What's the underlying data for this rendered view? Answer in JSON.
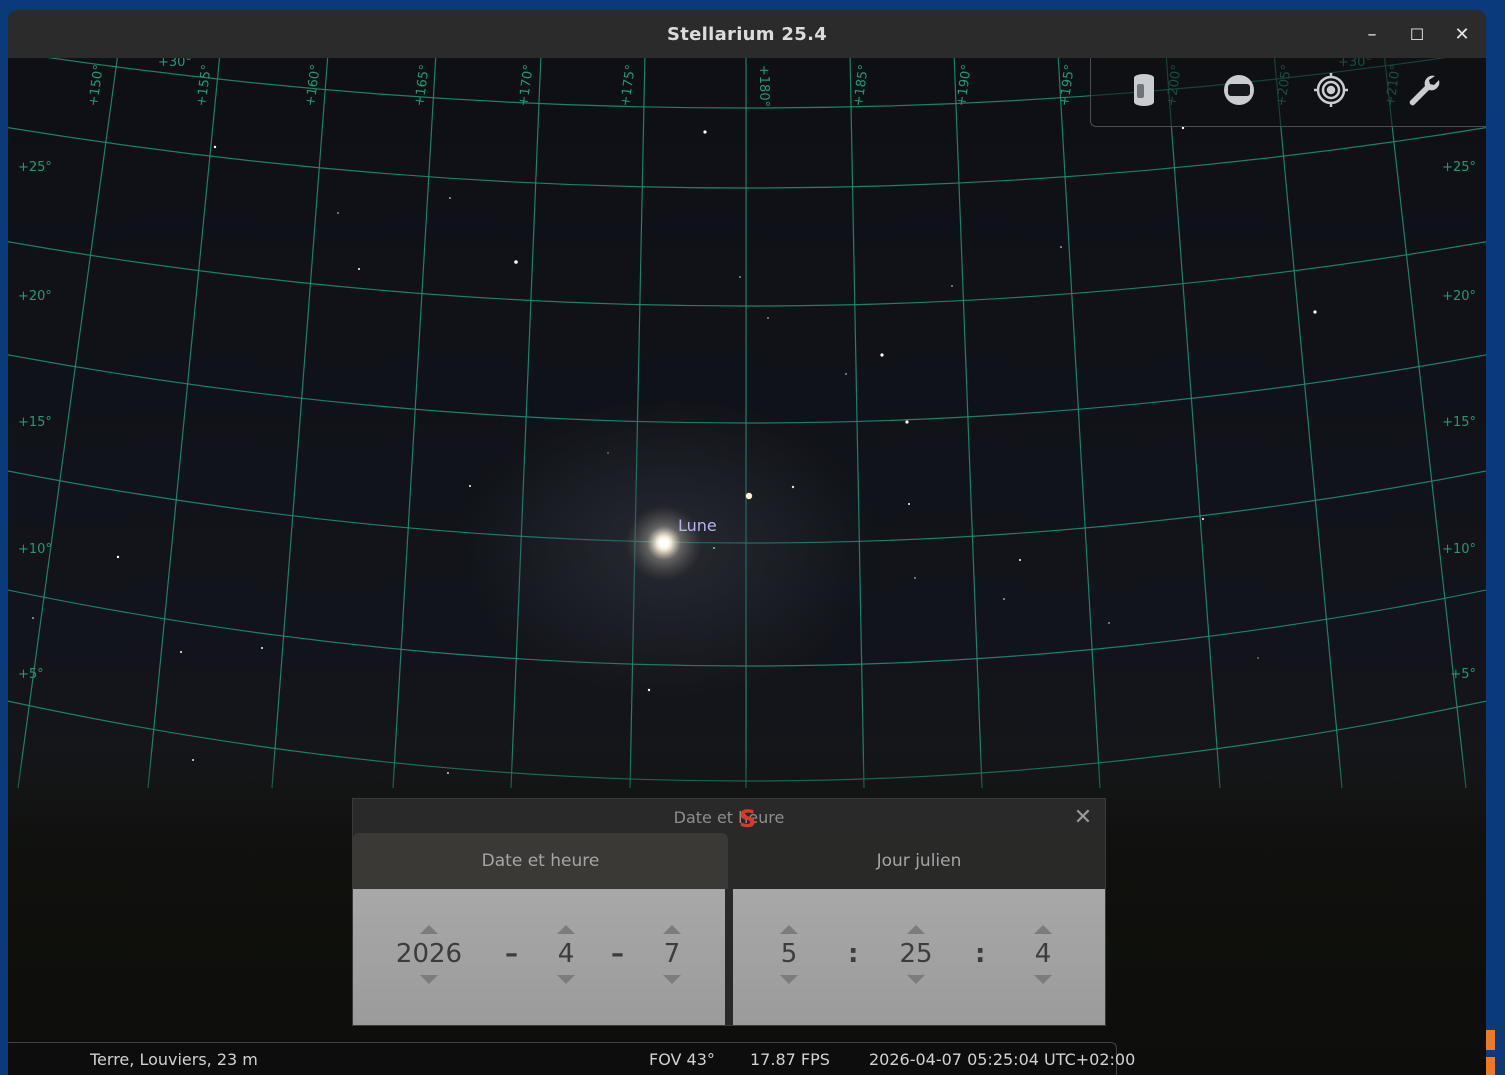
{
  "window": {
    "title": "Stellarium 25.4"
  },
  "controls": {
    "minimize": "–",
    "maximize": "☐",
    "close": "✕"
  },
  "sky": {
    "object_label": "Lune",
    "cardinal": "S",
    "ra_labels": [
      "+150°",
      "+155°",
      "+160°",
      "+165°",
      "+170°",
      "+175°",
      "+180°",
      "+185°",
      "+190°",
      "+195°",
      "+200°",
      "+205°",
      "+210°"
    ],
    "ra_top_fragments": [
      "+30°",
      "+30°"
    ],
    "dec_labels": [
      "+25°",
      "+20°",
      "+15°",
      "+10°",
      "+5°"
    ],
    "grid_color": "#1c8f72",
    "label_color": "#1f9a78"
  },
  "toolbar": {
    "icons": [
      "telescope-icon",
      "flip-view-icon",
      "target-icon",
      "wrench-icon"
    ]
  },
  "dialog": {
    "title": "Date et heure",
    "tabs": [
      {
        "label": "Date et heure",
        "active": true
      },
      {
        "label": "Jour julien",
        "active": false
      }
    ],
    "date": {
      "year": "2026",
      "month": "4",
      "day": "7",
      "sep": "–"
    },
    "time": {
      "hour": "5",
      "minute": "25",
      "second": "4",
      "sep": ":"
    }
  },
  "status": {
    "location": "Terre, Louviers, 23 m",
    "fov": "FOV 43°",
    "fps": "17.87 FPS",
    "datetime": "2026-04-07 05:25:04 UTC+02:00"
  }
}
